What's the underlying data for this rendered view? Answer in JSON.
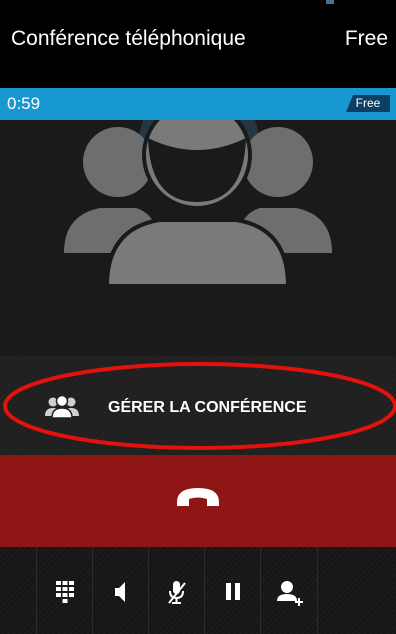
{
  "status_bar": {
    "title": "Conférence téléphonique",
    "carrier": "Free"
  },
  "call": {
    "timer": "0:59",
    "network_badge": "Free",
    "photo_icon": "conference-avatar-icon"
  },
  "manage_conference": {
    "label": "GÉRER LA CONFÉRENCE",
    "icon": "conference-group-icon",
    "highlight_color": "#e3120b"
  },
  "end_call": {
    "icon": "phone-hangup-icon",
    "color": "#8c1414"
  },
  "controls": [
    {
      "name": "dialpad",
      "icon": "dialpad-icon"
    },
    {
      "name": "speaker",
      "icon": "speaker-icon"
    },
    {
      "name": "mute",
      "icon": "microphone-mute-icon"
    },
    {
      "name": "hold",
      "icon": "pause-icon"
    },
    {
      "name": "add-call",
      "icon": "add-person-icon"
    }
  ],
  "colors": {
    "timer_bar": "#1798d0",
    "badge": "#0b3f63"
  }
}
